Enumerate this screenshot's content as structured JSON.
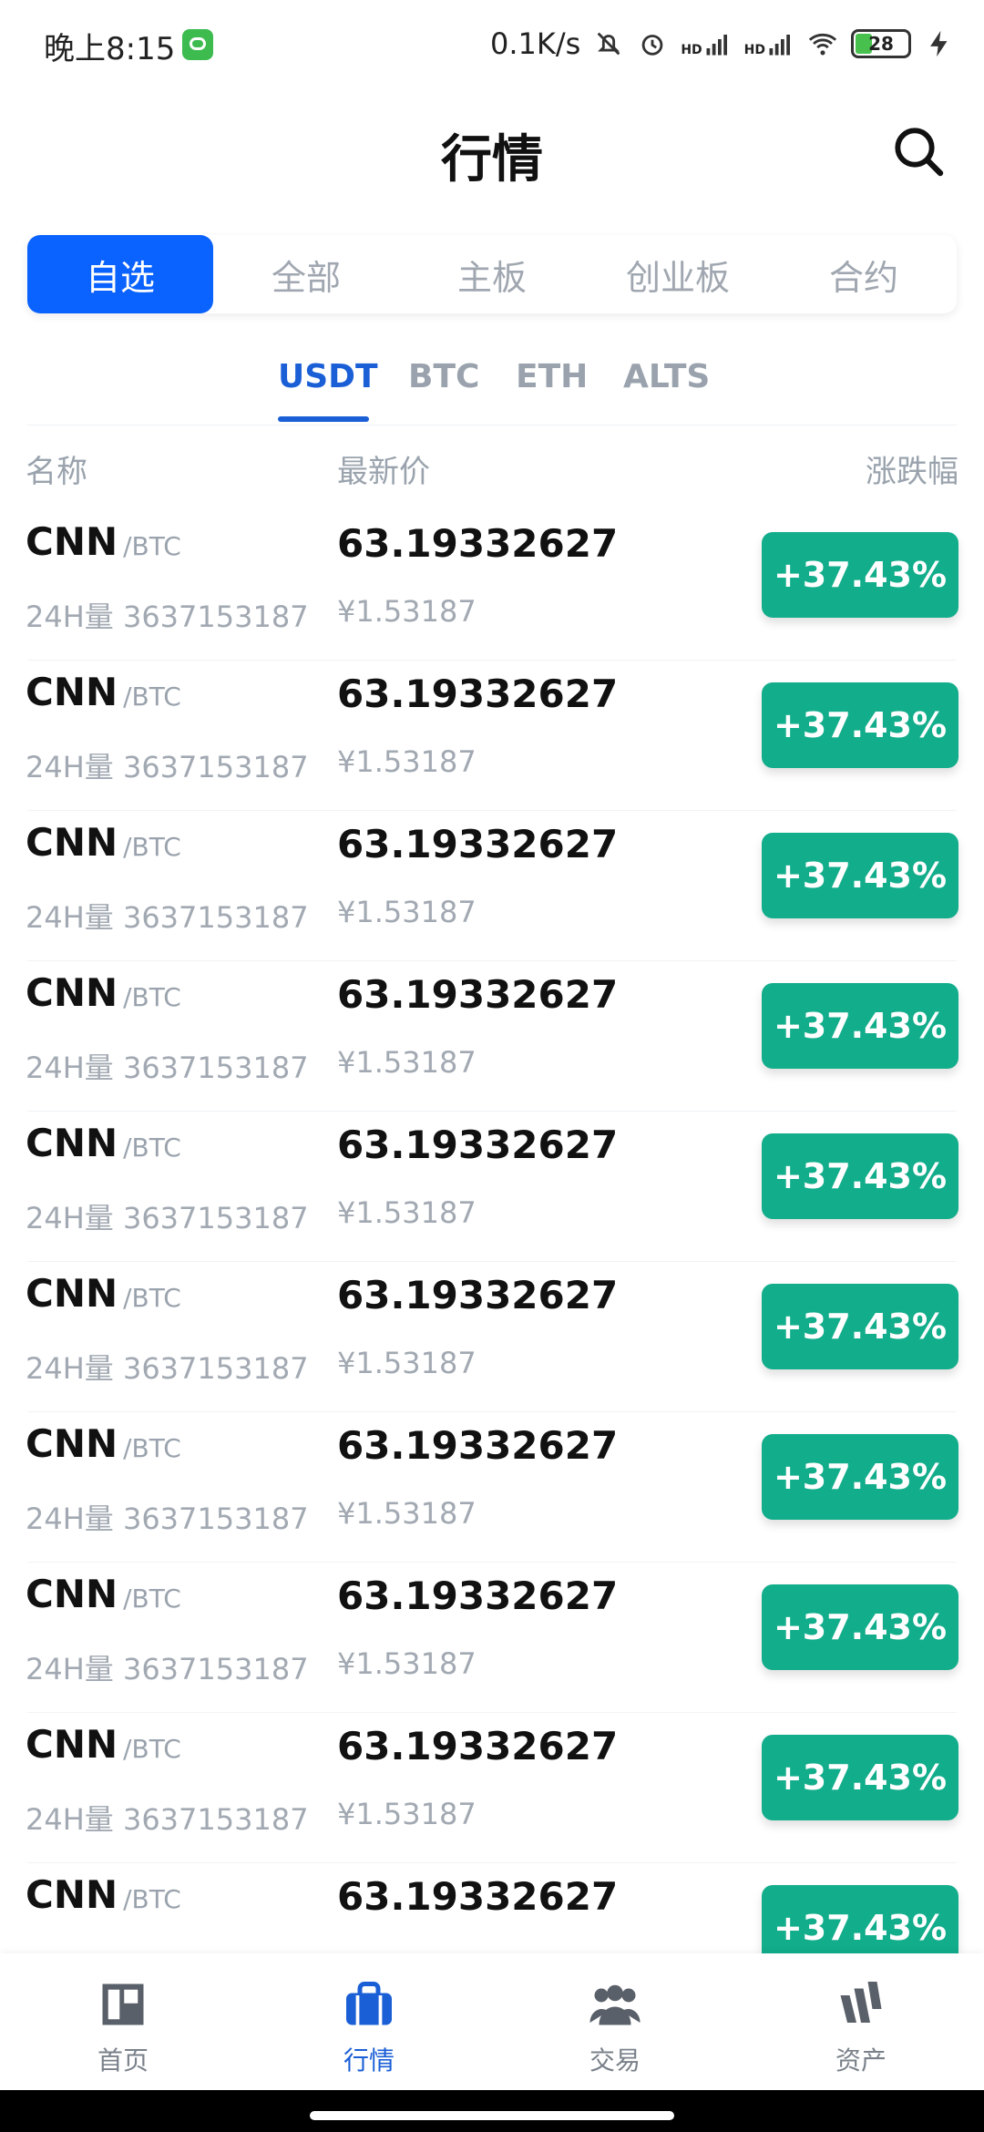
{
  "status": {
    "time": "晚上8:15",
    "net_speed": "0.1K/s",
    "sig1_label": "HD",
    "sig2_label": "HD",
    "battery": "28",
    "colors": {
      "battery": "#47c04d",
      "app_icon": "#3dbb4f"
    }
  },
  "header": {
    "title": "行情"
  },
  "seg_tabs": [
    {
      "label": "自选",
      "active": true
    },
    {
      "label": "全部"
    },
    {
      "label": "主板"
    },
    {
      "label": "创业板"
    },
    {
      "label": "合约"
    }
  ],
  "market_tabs": [
    {
      "label": "USDT",
      "active": true
    },
    {
      "label": "BTC"
    },
    {
      "label": "ETH"
    },
    {
      "label": "ALTS"
    }
  ],
  "columns": {
    "name": "名称",
    "price": "最新价",
    "change": "涨跌幅"
  },
  "rows": [
    {
      "symbol": "CNN",
      "quote": "/BTC",
      "volume": "24H量 3637153187",
      "price": "63.19332627",
      "cny": "¥1.53187",
      "change": "+37.43%"
    },
    {
      "symbol": "CNN",
      "quote": "/BTC",
      "volume": "24H量 3637153187",
      "price": "63.19332627",
      "cny": "¥1.53187",
      "change": "+37.43%"
    },
    {
      "symbol": "CNN",
      "quote": "/BTC",
      "volume": "24H量 3637153187",
      "price": "63.19332627",
      "cny": "¥1.53187",
      "change": "+37.43%"
    },
    {
      "symbol": "CNN",
      "quote": "/BTC",
      "volume": "24H量 3637153187",
      "price": "63.19332627",
      "cny": "¥1.53187",
      "change": "+37.43%"
    },
    {
      "symbol": "CNN",
      "quote": "/BTC",
      "volume": "24H量 3637153187",
      "price": "63.19332627",
      "cny": "¥1.53187",
      "change": "+37.43%"
    },
    {
      "symbol": "CNN",
      "quote": "/BTC",
      "volume": "24H量 3637153187",
      "price": "63.19332627",
      "cny": "¥1.53187",
      "change": "+37.43%"
    },
    {
      "symbol": "CNN",
      "quote": "/BTC",
      "volume": "24H量 3637153187",
      "price": "63.19332627",
      "cny": "¥1.53187",
      "change": "+37.43%"
    },
    {
      "symbol": "CNN",
      "quote": "/BTC",
      "volume": "24H量 3637153187",
      "price": "63.19332627",
      "cny": "¥1.53187",
      "change": "+37.43%"
    },
    {
      "symbol": "CNN",
      "quote": "/BTC",
      "volume": "24H量 3637153187",
      "price": "63.19332627",
      "cny": "¥1.53187",
      "change": "+37.43%"
    },
    {
      "symbol": "CNN",
      "quote": "/BTC",
      "price": "63.19332627",
      "change": "+37.43%"
    }
  ],
  "bottom_nav": [
    {
      "label": "首页",
      "icon": "home-icon"
    },
    {
      "label": "行情",
      "icon": "briefcase-icon",
      "active": true
    },
    {
      "label": "交易",
      "icon": "users-icon"
    },
    {
      "label": "资产",
      "icon": "assets-icon"
    }
  ],
  "colors": {
    "accent": "#0a62ff",
    "up": "#12ad8b",
    "muted": "#9aa3ad"
  }
}
